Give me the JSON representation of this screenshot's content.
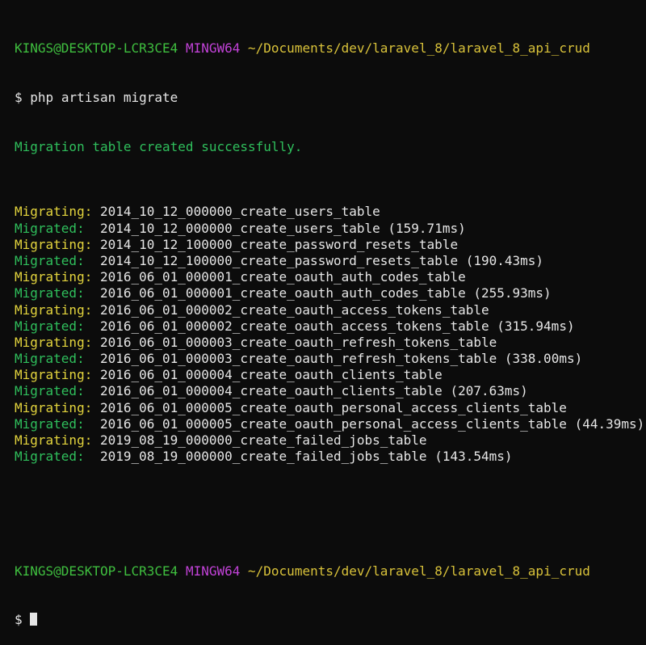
{
  "colors": {
    "background": "#0c0c0c",
    "user_host": "#3fbf3f",
    "mingw": "#c242d8",
    "path": "#d9c23a",
    "text": "#e6e6e6",
    "success": "#2fbf5c",
    "migrating": "#e3d43d"
  },
  "prompt1": {
    "user_host": "KINGS@DESKTOP-LCR3CE4",
    "env": "MINGW64",
    "path": "~/Documents/dev/laravel_8/laravel_8_api_crud"
  },
  "command": {
    "symbol": "$",
    "text": "php artisan migrate"
  },
  "info_line": "Migration table created successfully.",
  "migration_lines": [
    {
      "status": "Migrating:",
      "name": "2014_10_12_000000_create_users_table",
      "time": ""
    },
    {
      "status": "Migrated: ",
      "name": "2014_10_12_000000_create_users_table",
      "time": "(159.71ms)"
    },
    {
      "status": "Migrating:",
      "name": "2014_10_12_100000_create_password_resets_table",
      "time": ""
    },
    {
      "status": "Migrated: ",
      "name": "2014_10_12_100000_create_password_resets_table",
      "time": "(190.43ms)"
    },
    {
      "status": "Migrating:",
      "name": "2016_06_01_000001_create_oauth_auth_codes_table",
      "time": ""
    },
    {
      "status": "Migrated: ",
      "name": "2016_06_01_000001_create_oauth_auth_codes_table",
      "time": "(255.93ms)"
    },
    {
      "status": "Migrating:",
      "name": "2016_06_01_000002_create_oauth_access_tokens_table",
      "time": ""
    },
    {
      "status": "Migrated: ",
      "name": "2016_06_01_000002_create_oauth_access_tokens_table",
      "time": "(315.94ms)"
    },
    {
      "status": "Migrating:",
      "name": "2016_06_01_000003_create_oauth_refresh_tokens_table",
      "time": ""
    },
    {
      "status": "Migrated: ",
      "name": "2016_06_01_000003_create_oauth_refresh_tokens_table",
      "time": "(338.00ms)"
    },
    {
      "status": "Migrating:",
      "name": "2016_06_01_000004_create_oauth_clients_table",
      "time": ""
    },
    {
      "status": "Migrated: ",
      "name": "2016_06_01_000004_create_oauth_clients_table",
      "time": "(207.63ms)"
    },
    {
      "status": "Migrating:",
      "name": "2016_06_01_000005_create_oauth_personal_access_clients_table",
      "time": ""
    },
    {
      "status": "Migrated: ",
      "name": "2016_06_01_000005_create_oauth_personal_access_clients_table",
      "time": "(44.39ms)"
    },
    {
      "status": "Migrating:",
      "name": "2019_08_19_000000_create_failed_jobs_table",
      "time": ""
    },
    {
      "status": "Migrated: ",
      "name": "2019_08_19_000000_create_failed_jobs_table",
      "time": "(143.54ms)"
    }
  ],
  "prompt2": {
    "user_host": "KINGS@DESKTOP-LCR3CE4",
    "env": "MINGW64",
    "path": "~/Documents/dev/laravel_8/laravel_8_api_crud",
    "symbol": "$"
  }
}
